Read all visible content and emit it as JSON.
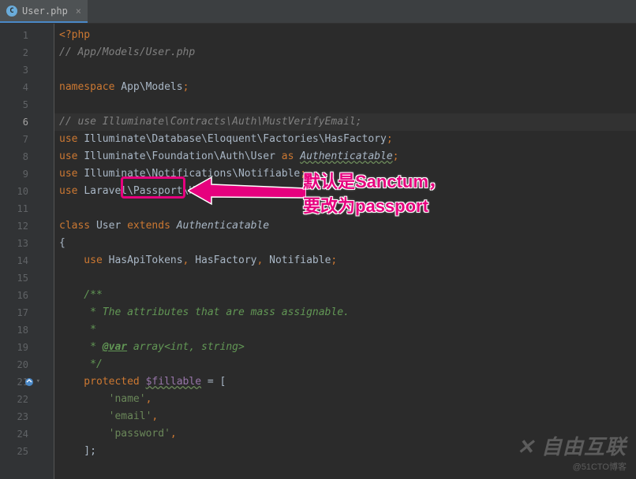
{
  "tab": {
    "filename": "User.php"
  },
  "lines": [
    {
      "n": "1"
    },
    {
      "n": "2"
    },
    {
      "n": "3"
    },
    {
      "n": "4"
    },
    {
      "n": "5"
    },
    {
      "n": "6"
    },
    {
      "n": "7"
    },
    {
      "n": "8"
    },
    {
      "n": "9"
    },
    {
      "n": "10"
    },
    {
      "n": "11"
    },
    {
      "n": "12"
    },
    {
      "n": "13"
    },
    {
      "n": "14"
    },
    {
      "n": "15"
    },
    {
      "n": "16"
    },
    {
      "n": "17"
    },
    {
      "n": "18"
    },
    {
      "n": "19"
    },
    {
      "n": "20"
    },
    {
      "n": "21"
    },
    {
      "n": "22"
    },
    {
      "n": "23"
    },
    {
      "n": "24"
    },
    {
      "n": "25"
    }
  ],
  "code": {
    "l1a": "<?php",
    "l2": "// App/Models/User.php",
    "l4a": "namespace ",
    "l4b": "App\\Models",
    "l4c": ";",
    "l6": "// use Illuminate\\Contracts\\Auth\\MustVerifyEmail;",
    "l7a": "use ",
    "l7b": "Illuminate\\Database\\Eloquent\\Factories\\HasFactory",
    "l7c": ";",
    "l8a": "use ",
    "l8b": "Illuminate\\Foundation\\Auth\\User ",
    "l8c": "as ",
    "l8d": "Authenticatable",
    "l8e": ";",
    "l9a": "use ",
    "l9b": "Illuminate\\Notifications\\Notifiable",
    "l9c": ";",
    "l10a": "use ",
    "l10b": "Laravel\\Passport\\HasApiTokens",
    "l10c": ";",
    "l12a": "class ",
    "l12b": "User ",
    "l12c": "extends ",
    "l12d": "Authenticatable",
    "l13": "{",
    "l14a": "    use ",
    "l14b": "HasApiTokens",
    "l14c": ", ",
    "l14d": "HasFactory",
    "l14e": ", ",
    "l14f": "Notifiable",
    "l14g": ";",
    "l16": "    /**",
    "l17": "     * The attributes that are mass assignable.",
    "l18": "     *",
    "l19a": "     * ",
    "l19b": "@var",
    "l19c": " array<int, string>",
    "l20": "     */",
    "l21a": "    protected ",
    "l21b": "$fillable",
    "l21c": " = [",
    "l22a": "        ",
    "l22b": "'name'",
    "l22c": ",",
    "l23a": "        ",
    "l23b": "'email'",
    "l23c": ",",
    "l24a": "        ",
    "l24b": "'password'",
    "l24c": ",",
    "l25": "    ];"
  },
  "annotation": {
    "line1": "默认是Sanctum，",
    "line2": "要改为passport"
  },
  "watermark": {
    "logo": "自由互联",
    "sub": "@51CTO博客"
  }
}
